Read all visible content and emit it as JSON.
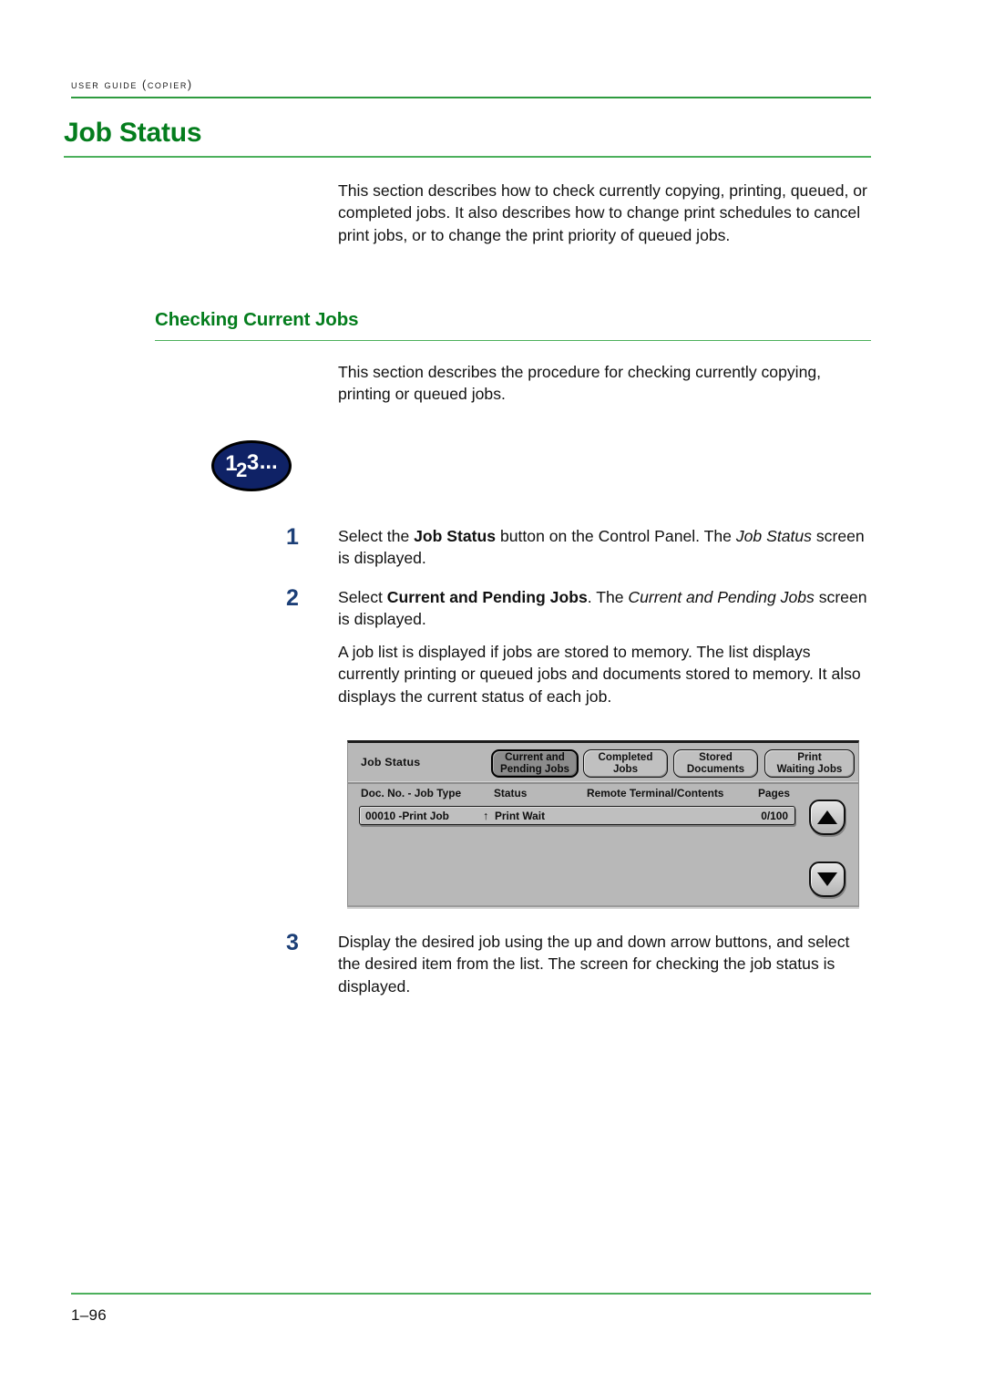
{
  "header": {
    "running_head": "User Guide (Copier)"
  },
  "h1": {
    "title": "Job Status"
  },
  "intro": {
    "paragraph": "This section describes how to check currently copying, printing, queued, or completed jobs. It also describes how to change print schedules to cancel print jobs, or to change the print priority of queued jobs."
  },
  "h2": {
    "title": "Checking Current Jobs"
  },
  "section_intro": {
    "paragraph": "This section describes the procedure for checking currently copying, printing or queued jobs."
  },
  "badge": {
    "digit_1": "1",
    "digit_2": "2",
    "digit_3": "3",
    "dots": "..."
  },
  "steps": [
    {
      "number": "1",
      "text_1": "Select the ",
      "bold_1": "Job Status",
      "text_2": " button on the Control Panel. The ",
      "italic_1": "Job Status",
      "text_3": " screen is displayed."
    },
    {
      "number": "2",
      "text_1": "Select ",
      "bold_1": "Current and Pending Jobs",
      "text_2": ". The ",
      "italic_1": "Current and Pending Jobs",
      "text_3": " screen is displayed."
    },
    {
      "number": "3",
      "text_1": "Display the desired job using the up and down arrow buttons, and select the desired item from the list. The screen for checking the job status is displayed."
    }
  ],
  "memory_note": {
    "paragraph": "A job list is displayed if jobs are stored to memory. The list displays currently printing or queued jobs and documents stored to memory. It also displays the current status of each job."
  },
  "copier_ui": {
    "panel_title": "Job Status",
    "tabs": [
      {
        "label": "Current and Pending Jobs",
        "line1": "Current and",
        "line2": "Pending Jobs",
        "selected": true
      },
      {
        "label": "Completed Jobs",
        "line1": "Completed Jobs",
        "line2": "",
        "selected": false
      },
      {
        "label": "Stored Documents",
        "line1": "Stored",
        "line2": "Documents",
        "selected": false
      },
      {
        "label": "Print Waiting Jobs",
        "line1": "Print",
        "line2": "Waiting Jobs",
        "selected": false
      }
    ],
    "columns": {
      "doc_no_job_type": "Doc. No. - Job Type",
      "status": "Status",
      "remote_terminal_contents": "Remote Terminal/Contents",
      "pages": "Pages"
    },
    "rows": [
      {
        "doc_no_job_type": "00010  -Print Job",
        "status_arrow": "↑",
        "status": "Print Wait",
        "remote_terminal_contents": "",
        "pages": "0/100"
      }
    ],
    "scroll_up": "▲",
    "scroll_down": "▼",
    "colors": {
      "panel_background": "#b8b8b8",
      "tab_selected": "#8c8c8c",
      "tab_unselected": "#c0c0c0"
    }
  },
  "footer": {
    "page_number": "1–96"
  },
  "theme": {
    "heading_green": "#047d1d",
    "rule_green": "#4cb05c",
    "rule_green_dark": "#2e9b3f",
    "step_number_blue": "#1c3f77",
    "badge_navy": "#0f2266"
  }
}
